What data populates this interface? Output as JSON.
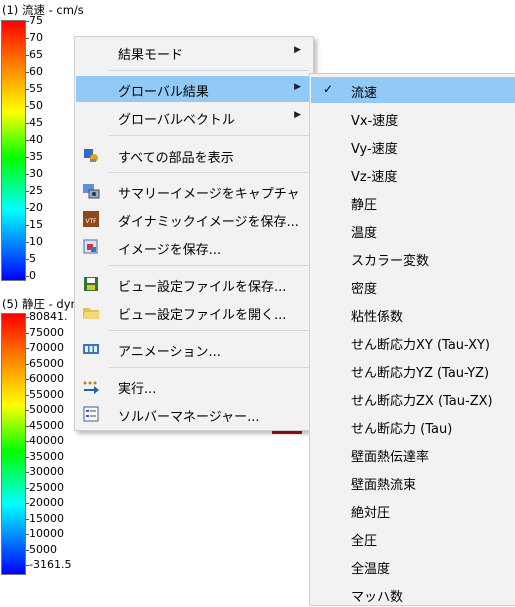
{
  "legend1": {
    "title": "(1) 流速 - cm/s",
    "ticks": [
      "75",
      "70",
      "65",
      "60",
      "55",
      "50",
      "45",
      "40",
      "35",
      "30",
      "25",
      "20",
      "15",
      "10",
      "5",
      "0"
    ]
  },
  "legend2": {
    "title": "(5) 静圧 - dyn",
    "ticks": [
      "80841.",
      "75000",
      "70000",
      "65000",
      "60000",
      "55000",
      "50000",
      "45000",
      "40000",
      "35000",
      "30000",
      "25000",
      "20000",
      "15000",
      "10000",
      "5000",
      "-3161.5"
    ]
  },
  "context_menu": {
    "items": [
      {
        "label": "結果モード",
        "icon": "none",
        "submenu": true
      },
      {
        "label": "グローバル結果",
        "icon": "none",
        "submenu": true,
        "highlighted": true
      },
      {
        "label": "グローバルベクトル",
        "icon": "none",
        "submenu": true
      },
      {
        "label": "すべての部品を表示",
        "icon": "show-all-parts-icon"
      },
      {
        "label": "サマリーイメージをキャプチャ",
        "icon": "capture-summary-image-icon"
      },
      {
        "label": "ダイナミックイメージを保存...",
        "icon": "vtf-file-icon"
      },
      {
        "label": "イメージを保存...",
        "icon": "save-image-icon"
      },
      {
        "label": "ビュー設定ファイルを保存...",
        "icon": "floppy-disk-icon"
      },
      {
        "label": "ビュー設定ファイルを開く...",
        "icon": "open-folder-icon"
      },
      {
        "label": "アニメーション...",
        "icon": "film-strip-icon"
      },
      {
        "label": "実行...",
        "icon": "run-arrow-icon"
      },
      {
        "label": "ソルバーマネージャー...",
        "icon": "solver-manager-icon"
      }
    ],
    "submenu_arrow": "▶"
  },
  "submenu": {
    "check_mark": "✓",
    "items": [
      "流速",
      "Vx-速度",
      "Vy-速度",
      "Vz-速度",
      "静圧",
      "温度",
      "スカラー変数",
      "密度",
      "粘性係数",
      "せん断応力XY (Tau-XY)",
      "せん断応力YZ (Tau-YZ)",
      "せん断応力ZX (Tau-ZX)",
      "せん断応力 (Tau)",
      "壁面熱伝達率",
      "壁面熱流束",
      "絶対圧",
      "全圧",
      "全温度",
      "マッハ数"
    ],
    "checked_index": 0
  },
  "colors": {
    "highlight": "#91c9f7",
    "menu_background": "#f2f2f2",
    "legend_gradient": [
      "#ff0000",
      "#ff8000",
      "#ffff00",
      "#00ff00",
      "#00ffff",
      "#0000ff"
    ]
  }
}
